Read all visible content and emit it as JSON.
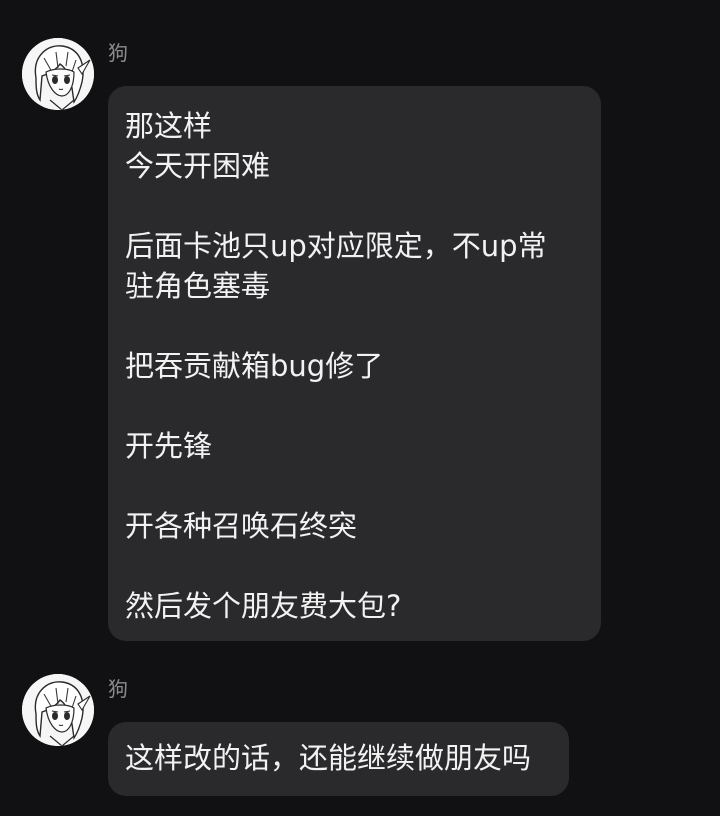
{
  "messages": [
    {
      "sender": "狗",
      "lines": [
        "那这样",
        "今天开困难",
        "",
        "后面卡池只up对应限定，不up常",
        "驻角色塞毒",
        "",
        "把吞贡献箱bug修了",
        "",
        "开先锋",
        "",
        "开各种召唤石终突",
        "",
        "然后发个朋友费大包?"
      ]
    },
    {
      "sender": "狗",
      "lines": [
        "这样改的话，还能继续做朋友吗"
      ]
    }
  ]
}
